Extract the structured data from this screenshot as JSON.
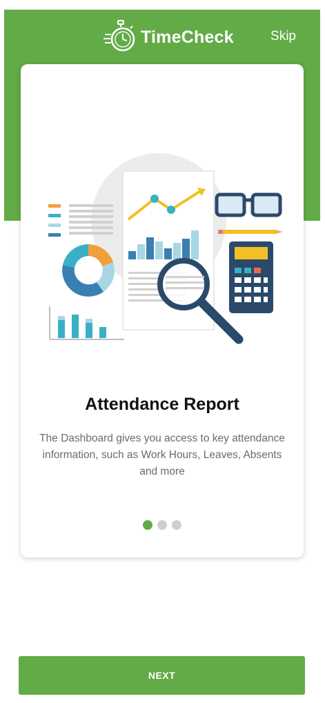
{
  "app": {
    "name": "TimeCheck",
    "skip_label": "Skip"
  },
  "onboarding": {
    "title": "Attendance Report",
    "description": "The Dashboard gives you access to key attendance information, such as Work Hours, Leaves, Absents and more",
    "illustration_icon": "report-analytics-illustration",
    "pagination": {
      "total": 3,
      "active_index": 0
    }
  },
  "footer": {
    "next_label": "NEXT"
  },
  "colors": {
    "brand_green": "#62ab47",
    "dot_inactive": "#cfcfcf",
    "title_text": "#111111",
    "body_text": "#6b6b6b"
  }
}
